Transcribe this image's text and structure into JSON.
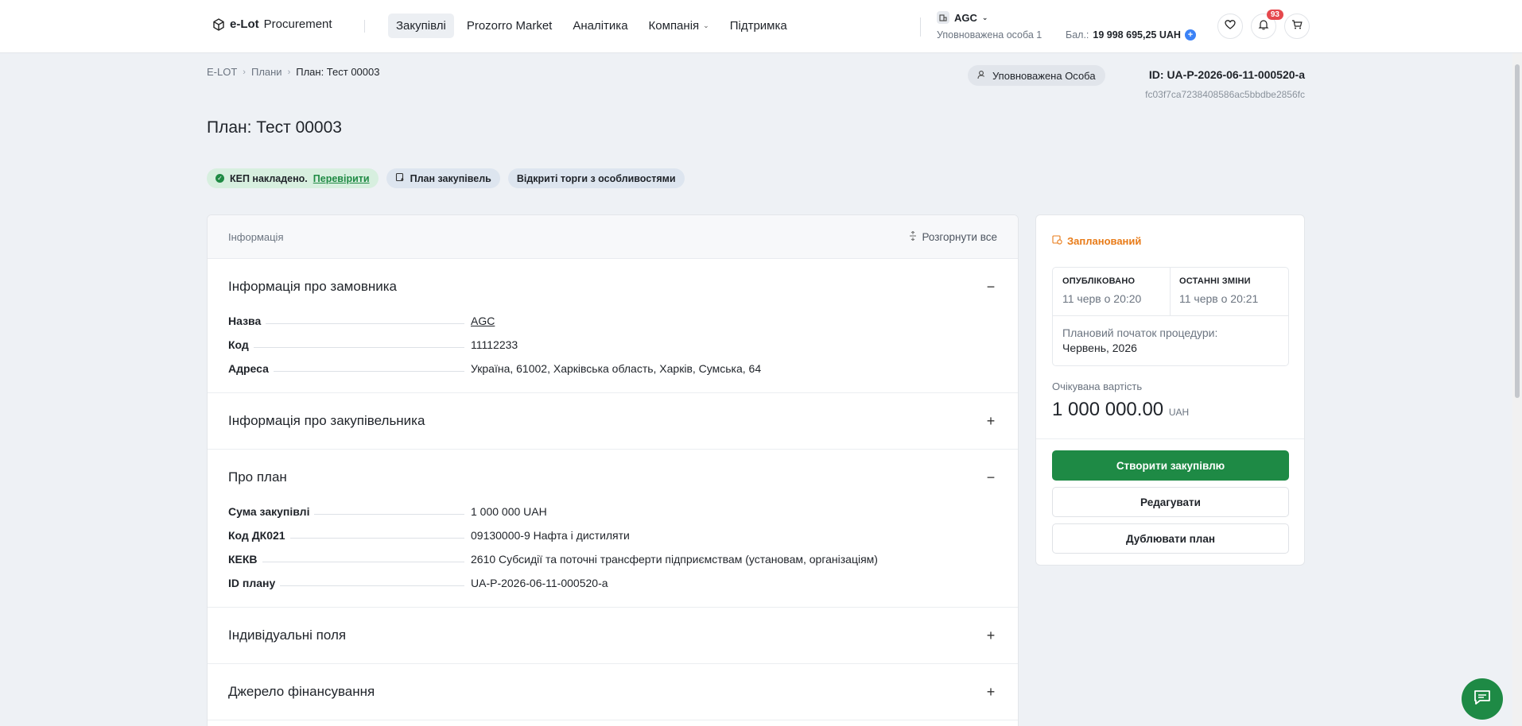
{
  "header": {
    "logo_bold": "e-Lot",
    "logo_rest": "Procurement",
    "nav": [
      "Закупівлі",
      "Prozorro Market",
      "Аналітика",
      "Компанія",
      "Підтримка"
    ],
    "org_name": "AGC",
    "org_role": "Уповноважена особа 1",
    "balance_label": "Бал.:",
    "balance_value": "19 998 695,25 UAH",
    "notifications": "93"
  },
  "breadcrumb": [
    "E-LOT",
    "Плани",
    "План: Тест 00003"
  ],
  "meta": {
    "role_pill": "Уповноважена Особа",
    "plan_id": "ID: UA-P-2026-06-11-000520-a",
    "hash": "fc03f7ca7238408586ac5bbdbe2856fc"
  },
  "title": "План: Тест 00003",
  "tags": {
    "kep": "КЕП накладено.",
    "verify": "Перевірити",
    "plan": "План закупівель",
    "open": "Відкриті торги з особливостями"
  },
  "card": {
    "head_label": "Інформація",
    "expand_all": "Розгорнути все",
    "sections": [
      {
        "title": "Інформація про замовника",
        "toggle": "−",
        "rows": [
          {
            "k": "Назва",
            "v": "AGC"
          },
          {
            "k": "Код",
            "v": "11112233"
          },
          {
            "k": "Адреса",
            "v": "Україна, 61002, Харківська область, Харків, Сумська, 64"
          }
        ]
      },
      {
        "title": "Інформація про закупівельника",
        "toggle": "+"
      },
      {
        "title": "Про план",
        "toggle": "−",
        "rows": [
          {
            "k": "Сума закупівлі",
            "v": "1 000 000 UAH"
          },
          {
            "k": "Код ДК021",
            "v": "09130000-9 Нафта і дистиляти"
          },
          {
            "k": "КЕКВ",
            "v": "2610 Субсидії та поточні трансферти підприємствам (установам, організаціям)"
          },
          {
            "k": "ID плану",
            "v": "UA-P-2026-06-11-000520-a"
          }
        ]
      },
      {
        "title": "Індивідуальні поля",
        "toggle": "+"
      },
      {
        "title": "Джерело фінансування",
        "toggle": "+"
      }
    ]
  },
  "side": {
    "status": "Запланований",
    "published_label": "ОПУБЛІКОВАНО",
    "published_value": "11 черв о 20:20",
    "changed_label": "ОСТАННІ ЗМІНИ",
    "changed_value": "11 черв о 20:21",
    "planned_label": "Плановий початок процедури:",
    "planned_value": "Червень, 2026",
    "expected_label": "Очікувана вартість",
    "expected_value": "1 000 000.00",
    "expected_currency": "UAH",
    "btn_create": "Створити закупівлю",
    "btn_edit": "Редагувати",
    "btn_duplicate": "Дублювати план"
  },
  "colors": {
    "accent_green": "#1e8a45",
    "status_orange": "#e87b18",
    "notif_red": "#e5484d"
  }
}
